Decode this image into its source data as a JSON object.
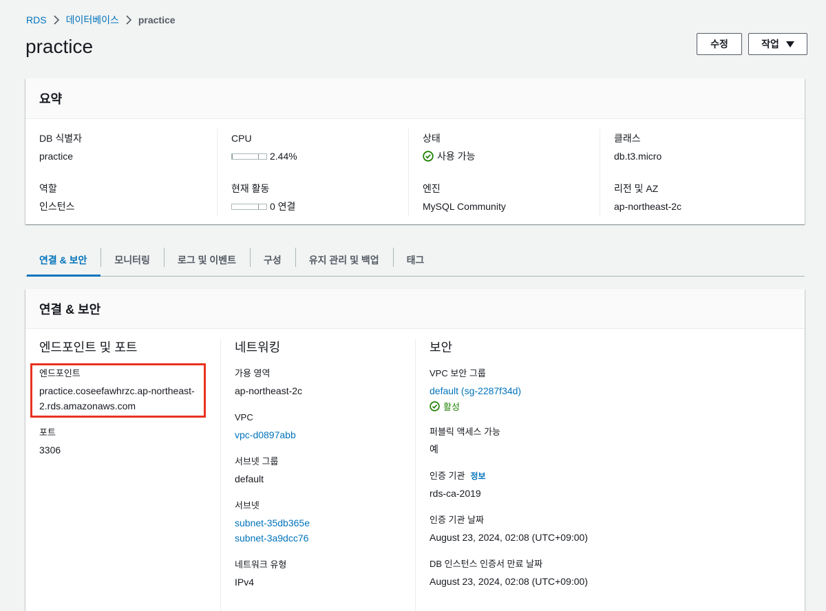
{
  "breadcrumb": [
    {
      "label": "RDS"
    },
    {
      "label": "데이터베이스"
    },
    {
      "label": "practice"
    }
  ],
  "page": {
    "title": "practice"
  },
  "actions": {
    "edit_label": "수정",
    "action_label": "작업"
  },
  "summary": {
    "title": "요약",
    "db_identifier_label": "DB 식별자",
    "db_identifier": "practice",
    "role_label": "역할",
    "role": "인스턴스",
    "cpu_label": "CPU",
    "cpu_value": "2.44%",
    "cpu_percent": 2.44,
    "activity_label": "현재 활동",
    "activity_value": "0 연결",
    "activity_percent": 0,
    "status_label": "상태",
    "status": "사용 가능",
    "engine_label": "엔진",
    "engine": "MySQL Community",
    "class_label": "클래스",
    "class": "db.t3.micro",
    "region_label": "리전 및 AZ",
    "region": "ap-northeast-2c"
  },
  "tabs": [
    {
      "label": "연결 & 보안",
      "active": true
    },
    {
      "label": "모니터링"
    },
    {
      "label": "로그 및 이벤트"
    },
    {
      "label": "구성"
    },
    {
      "label": "유지 관리 및 백업"
    },
    {
      "label": "태그"
    }
  ],
  "connectivity": {
    "title": "연결 & 보안",
    "endpoint_section": {
      "heading": "엔드포인트 및 포트",
      "endpoint_label": "엔드포인트",
      "endpoint_line1": "practice.coseefawhrzc.ap-northeast-",
      "endpoint_line2": "2.rds.amazonaws.com",
      "port_label": "포트",
      "port": "3306"
    },
    "network_section": {
      "heading": "네트워킹",
      "az_label": "가용 영역",
      "az": "ap-northeast-2c",
      "vpc_label": "VPC",
      "vpc": "vpc-d0897abb",
      "subnet_group_label": "서브넷 그룹",
      "subnet_group": "default",
      "subnets_label": "서브넷",
      "subnet1": "subnet-35db365e",
      "subnet2": "subnet-3a9dcc76",
      "network_type_label": "네트워크 유형",
      "network_type": "IPv4"
    },
    "security_section": {
      "heading": "보안",
      "vpc_sg_label": "VPC 보안 그룹",
      "vpc_sg": "default (sg-2287f34d)",
      "vpc_sg_status": "활성",
      "public_access_label": "퍼블릭 액세스 가능",
      "public_access": "예",
      "ca_label": "인증 기관",
      "ca_info": "정보",
      "ca": "rds-ca-2019",
      "ca_date_label": "인증 기관 날짜",
      "ca_date": "August 23, 2024, 02:08 (UTC+09:00)",
      "cert_expiry_label": "DB 인스턴스 인증서 만료 날짜",
      "cert_expiry": "August 23, 2024, 02:08 (UTC+09:00)"
    }
  },
  "colors": {
    "link": "#0073bb",
    "success": "#1d8102",
    "highlight": "#e8321f"
  }
}
